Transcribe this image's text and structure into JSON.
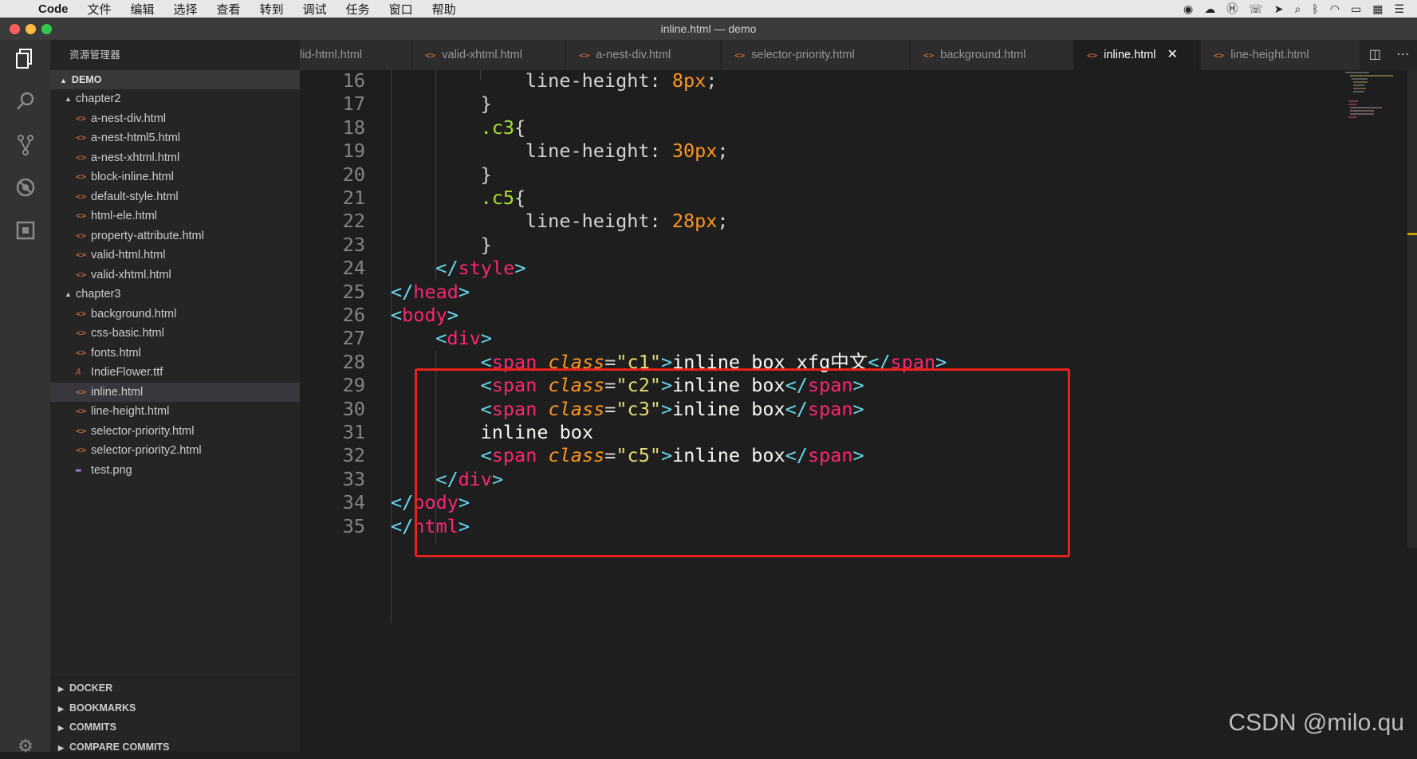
{
  "menubar": {
    "app_name": "Code",
    "items": [
      "文件",
      "编辑",
      "选择",
      "查看",
      "转到",
      "调试",
      "任务",
      "窗口",
      "帮助"
    ]
  },
  "window": {
    "title": "inline.html — demo"
  },
  "sidebar": {
    "title": "资源管理器",
    "root": "DEMO",
    "folders": [
      {
        "name": "chapter2",
        "files": [
          "a-nest-div.html",
          "a-nest-html5.html",
          "a-nest-xhtml.html",
          "block-inline.html",
          "default-style.html",
          "html-ele.html",
          "property-attribute.html",
          "valid-html.html",
          "valid-xhtml.html"
        ]
      },
      {
        "name": "chapter3",
        "files": [
          "background.html",
          "css-basic.html",
          "fonts.html",
          "IndieFlower.ttf",
          "inline.html",
          "line-height.html",
          "selector-priority.html",
          "selector-priority2.html",
          "test.png"
        ]
      }
    ],
    "selected_file": "inline.html",
    "bottom_sections": [
      "DOCKER",
      "BOOKMARKS",
      "COMMITS",
      "COMPARE COMMITS"
    ]
  },
  "tabs": [
    {
      "label": "lid-html.html",
      "active": false
    },
    {
      "label": "valid-xhtml.html",
      "active": false
    },
    {
      "label": "a-nest-div.html",
      "active": false
    },
    {
      "label": "selector-priority.html",
      "active": false
    },
    {
      "label": "background.html",
      "active": false
    },
    {
      "label": "inline.html",
      "active": true
    },
    {
      "label": "line-height.html",
      "active": false
    }
  ],
  "code_lines": [
    {
      "n": "16",
      "indent": 3,
      "tokens": [
        [
          "t-prop",
          "line-height: "
        ],
        [
          "t-num",
          "8px"
        ],
        [
          "t-prop",
          ";"
        ]
      ]
    },
    {
      "n": "17",
      "indent": 2,
      "tokens": [
        [
          "t-prop",
          "}"
        ]
      ]
    },
    {
      "n": "18",
      "indent": 2,
      "tokens": [
        [
          "t-sel",
          ".c3"
        ],
        [
          "t-prop",
          "{"
        ]
      ]
    },
    {
      "n": "19",
      "indent": 3,
      "tokens": [
        [
          "t-prop",
          "line-height: "
        ],
        [
          "t-num",
          "30px"
        ],
        [
          "t-prop",
          ";"
        ]
      ]
    },
    {
      "n": "20",
      "indent": 2,
      "tokens": [
        [
          "t-prop",
          "}"
        ]
      ]
    },
    {
      "n": "21",
      "indent": 2,
      "tokens": [
        [
          "t-sel",
          ".c5"
        ],
        [
          "t-prop",
          "{"
        ]
      ]
    },
    {
      "n": "22",
      "indent": 3,
      "tokens": [
        [
          "t-prop",
          "line-height: "
        ],
        [
          "t-num",
          "28px"
        ],
        [
          "t-prop",
          ";"
        ]
      ]
    },
    {
      "n": "23",
      "indent": 2,
      "tokens": [
        [
          "t-prop",
          "}"
        ]
      ]
    },
    {
      "n": "24",
      "indent": 1,
      "tokens": [
        [
          "t-punc",
          "</"
        ],
        [
          "t-tag",
          "style"
        ],
        [
          "t-punc",
          ">"
        ]
      ]
    },
    {
      "n": "25",
      "indent": 0,
      "tokens": [
        [
          "t-punc",
          "</"
        ],
        [
          "t-tag",
          "head"
        ],
        [
          "t-punc",
          ">"
        ]
      ]
    },
    {
      "n": "26",
      "indent": 0,
      "tokens": [
        [
          "t-punc",
          "<"
        ],
        [
          "t-tag",
          "body"
        ],
        [
          "t-punc",
          ">"
        ]
      ]
    },
    {
      "n": "27",
      "indent": 1,
      "tokens": [
        [
          "t-punc",
          "<"
        ],
        [
          "t-tag",
          "div"
        ],
        [
          "t-punc",
          ">"
        ]
      ]
    },
    {
      "n": "28",
      "indent": 2,
      "tokens": [
        [
          "t-punc",
          "<"
        ],
        [
          "t-tag",
          "span"
        ],
        [
          "t-text",
          " "
        ],
        [
          "t-attr",
          "class"
        ],
        [
          "t-prop",
          "="
        ],
        [
          "t-str",
          "\"c1\""
        ],
        [
          "t-punc",
          ">"
        ],
        [
          "t-text",
          "inline box xfg中文"
        ],
        [
          "t-punc",
          "</"
        ],
        [
          "t-tag",
          "span"
        ],
        [
          "t-punc",
          ">"
        ]
      ]
    },
    {
      "n": "29",
      "indent": 2,
      "tokens": [
        [
          "t-punc",
          "<"
        ],
        [
          "t-tag",
          "span"
        ],
        [
          "t-text",
          " "
        ],
        [
          "t-attr",
          "class"
        ],
        [
          "t-prop",
          "="
        ],
        [
          "t-str",
          "\"c2\""
        ],
        [
          "t-punc",
          ">"
        ],
        [
          "t-text",
          "inline box"
        ],
        [
          "t-punc",
          "</"
        ],
        [
          "t-tag",
          "span"
        ],
        [
          "t-punc",
          ">"
        ]
      ]
    },
    {
      "n": "30",
      "indent": 2,
      "tokens": [
        [
          "t-punc",
          "<"
        ],
        [
          "t-tag",
          "span"
        ],
        [
          "t-text",
          " "
        ],
        [
          "t-attr",
          "class"
        ],
        [
          "t-prop",
          "="
        ],
        [
          "t-str",
          "\"c3\""
        ],
        [
          "t-punc",
          ">"
        ],
        [
          "t-text",
          "inline box"
        ],
        [
          "t-punc",
          "</"
        ],
        [
          "t-tag",
          "span"
        ],
        [
          "t-punc",
          ">"
        ]
      ]
    },
    {
      "n": "31",
      "indent": 2,
      "tokens": [
        [
          "t-text",
          "inline box"
        ]
      ]
    },
    {
      "n": "32",
      "indent": 2,
      "tokens": [
        [
          "t-punc",
          "<"
        ],
        [
          "t-tag",
          "span"
        ],
        [
          "t-text",
          " "
        ],
        [
          "t-attr",
          "class"
        ],
        [
          "t-prop",
          "="
        ],
        [
          "t-str",
          "\"c5\""
        ],
        [
          "t-punc",
          ">"
        ],
        [
          "t-text",
          "inline box"
        ],
        [
          "t-punc",
          "</"
        ],
        [
          "t-tag",
          "span"
        ],
        [
          "t-punc",
          ">"
        ]
      ]
    },
    {
      "n": "33",
      "indent": 1,
      "tokens": [
        [
          "t-punc",
          "</"
        ],
        [
          "t-tag",
          "div"
        ],
        [
          "t-punc",
          ">"
        ]
      ]
    },
    {
      "n": "34",
      "indent": 0,
      "tokens": [
        [
          "t-punc",
          "</"
        ],
        [
          "t-tag",
          "body"
        ],
        [
          "t-punc",
          ">"
        ]
      ]
    },
    {
      "n": "35",
      "indent": 0,
      "tokens": [
        [
          "t-punc",
          "</"
        ],
        [
          "t-tag",
          "html"
        ],
        [
          "t-punc",
          ">"
        ]
      ]
    }
  ],
  "watermark": "CSDN @milo.qu",
  "colors": {
    "highlight_box": "#e8221b",
    "editor_bg": "#1e1e1e",
    "sidebar_bg": "#252526"
  }
}
